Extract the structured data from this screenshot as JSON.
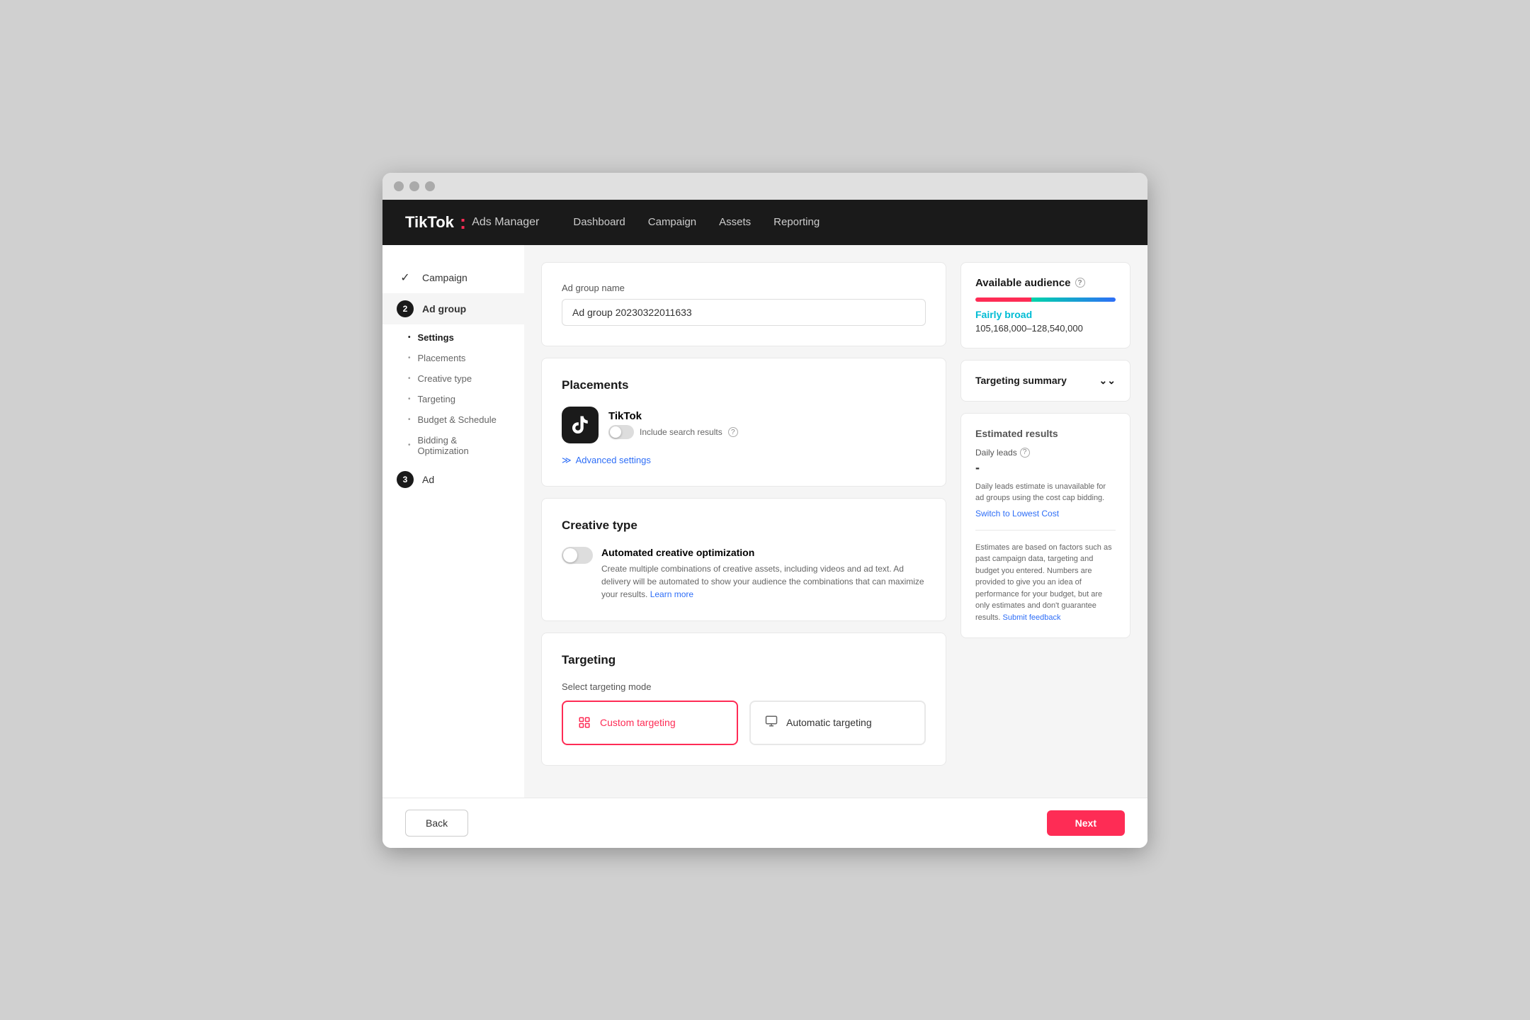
{
  "browser": {
    "traffic_lights": [
      "",
      "",
      ""
    ]
  },
  "nav": {
    "logo_tiktok": "TikTok",
    "logo_colon": ":",
    "logo_ads": "Ads Manager",
    "links": [
      {
        "label": "Dashboard"
      },
      {
        "label": "Campaign"
      },
      {
        "label": "Assets"
      },
      {
        "label": "Reporting"
      }
    ]
  },
  "sidebar": {
    "step1": {
      "label": "Campaign",
      "icon": "checkmark"
    },
    "step2": {
      "label": "Ad group",
      "number": "2"
    },
    "step2_active_sub": "Settings",
    "sub_items": [
      {
        "label": "Settings",
        "active": true
      },
      {
        "label": "Placements"
      },
      {
        "label": "Creative type"
      },
      {
        "label": "Targeting"
      },
      {
        "label": "Budget & Schedule"
      },
      {
        "label": "Bidding & Optimization"
      }
    ],
    "step3": {
      "label": "Ad",
      "number": "3"
    }
  },
  "ad_group_name": {
    "label": "Ad group name",
    "value": "Ad group 20230322011633"
  },
  "placements": {
    "title": "Placements",
    "tiktok_name": "TikTok",
    "include_search_label": "Include search results",
    "advanced_settings": "Advanced settings"
  },
  "creative_type": {
    "title": "Creative type",
    "toggle_label": "Automated creative optimization",
    "description": "Create multiple combinations of creative assets, including videos and ad text. Ad delivery will be automated to show your audience the combinations that can maximize your results.",
    "learn_more": "Learn more"
  },
  "targeting": {
    "title": "Targeting",
    "select_mode_label": "Select targeting mode",
    "custom_label": "Custom targeting",
    "automatic_label": "Automatic targeting"
  },
  "right_panel": {
    "available_audience_title": "Available audience",
    "audience_breadth": "Fairly broad",
    "audience_range": "105,168,000–128,540,000",
    "targeting_summary_title": "Targeting summary",
    "estimated_results_title": "Estimated results",
    "daily_leads_label": "Daily leads",
    "daily_leads_value": "-",
    "daily_leads_note": "Daily leads estimate is unavailable for ad groups using the cost cap bidding.",
    "switch_link": "Switch to Lowest Cost",
    "estimates_note": "Estimates are based on factors such as past campaign data, targeting and budget you entered. Numbers are provided to give you an idea of performance for your budget, but are only estimates and don't guarantee results.",
    "submit_feedback": "Submit feedback"
  },
  "footer": {
    "back_label": "Back",
    "next_label": "Next"
  }
}
